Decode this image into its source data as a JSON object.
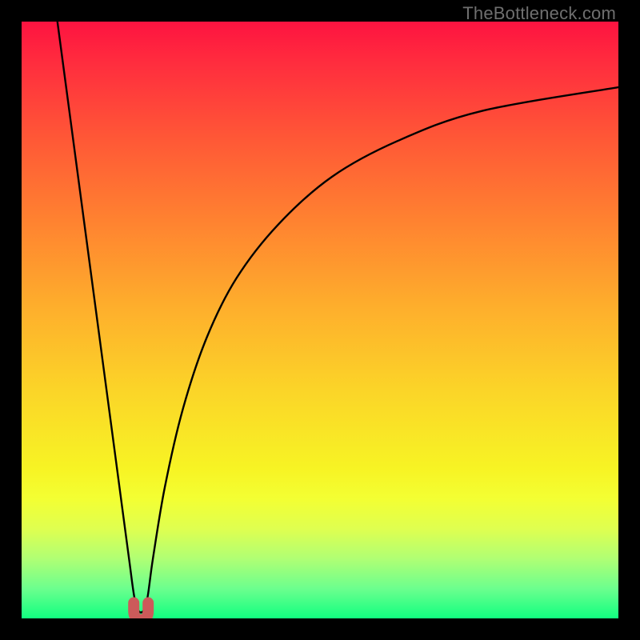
{
  "attribution": "TheBottleneck.com",
  "chart_data": {
    "type": "line",
    "title": "",
    "xlabel": "",
    "ylabel": "",
    "xlim": [
      0,
      100
    ],
    "ylim": [
      0,
      100
    ],
    "background_gradient": {
      "direction": "vertical",
      "stops": [
        {
          "pos": 0,
          "color": "#fe1340"
        },
        {
          "pos": 50,
          "color": "#feaf2c"
        },
        {
          "pos": 78,
          "color": "#f7f424"
        },
        {
          "pos": 100,
          "color": "#11ff80"
        }
      ]
    },
    "series": [
      {
        "name": "bottleneck-curve",
        "color": "#000000",
        "x": [
          6,
          8,
          10,
          12,
          14,
          16,
          18,
          19,
          20,
          21,
          22,
          24,
          27,
          31,
          36,
          43,
          52,
          63,
          77,
          100
        ],
        "y": [
          100,
          85,
          70,
          55,
          40,
          25,
          10,
          3,
          1,
          3,
          10,
          22,
          35,
          47,
          57,
          66,
          74,
          80,
          85,
          89
        ]
      }
    ],
    "marker": {
      "name": "optimal-point",
      "x": 20,
      "y": 1,
      "color": "#cc5a5a",
      "shape": "u"
    }
  }
}
